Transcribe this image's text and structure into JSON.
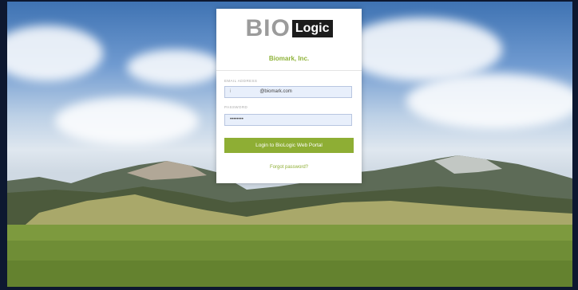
{
  "logo": {
    "part1": "BIO",
    "part2": "Logic"
  },
  "company_name": "Biomark, Inc.",
  "email": {
    "label": "EMAIL ADDRESS",
    "prefix": "i",
    "value": "@biomark.com"
  },
  "password": {
    "label": "PASSWORD",
    "value": "••••••••"
  },
  "login_button": "Login to BioLogic Web Portal",
  "forgot_link": "Forgot password?",
  "colors": {
    "accent": "#8eae34",
    "logo_dark": "#1c1c1c",
    "frame": "#0d1830"
  }
}
